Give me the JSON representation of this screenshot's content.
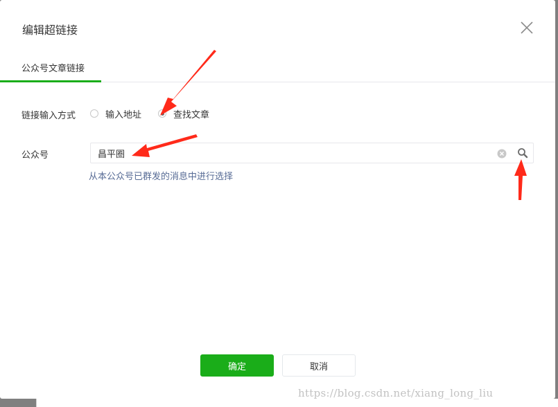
{
  "dialog": {
    "title": "编辑超链接",
    "close_icon": "close-icon"
  },
  "tabs": [
    {
      "label": "公众号文章链接",
      "active": true
    }
  ],
  "form": {
    "mode_label": "链接输入方式",
    "mode_options": [
      {
        "label": "输入地址",
        "checked": false
      },
      {
        "label": "查找文章",
        "checked": true
      }
    ],
    "account_label": "公众号",
    "account_value": "昌平圈",
    "clear_icon": "clear-icon",
    "search_icon": "search-icon",
    "hint": "从本公众号已群发的消息中进行选择"
  },
  "footer": {
    "confirm_label": "确定",
    "cancel_label": "取消"
  },
  "watermark": "https://blog.csdn.net/xiang_long_liu",
  "colors": {
    "primary": "#1aad19",
    "link": "#576b95",
    "annotation_arrow": "#ff2a1a"
  }
}
